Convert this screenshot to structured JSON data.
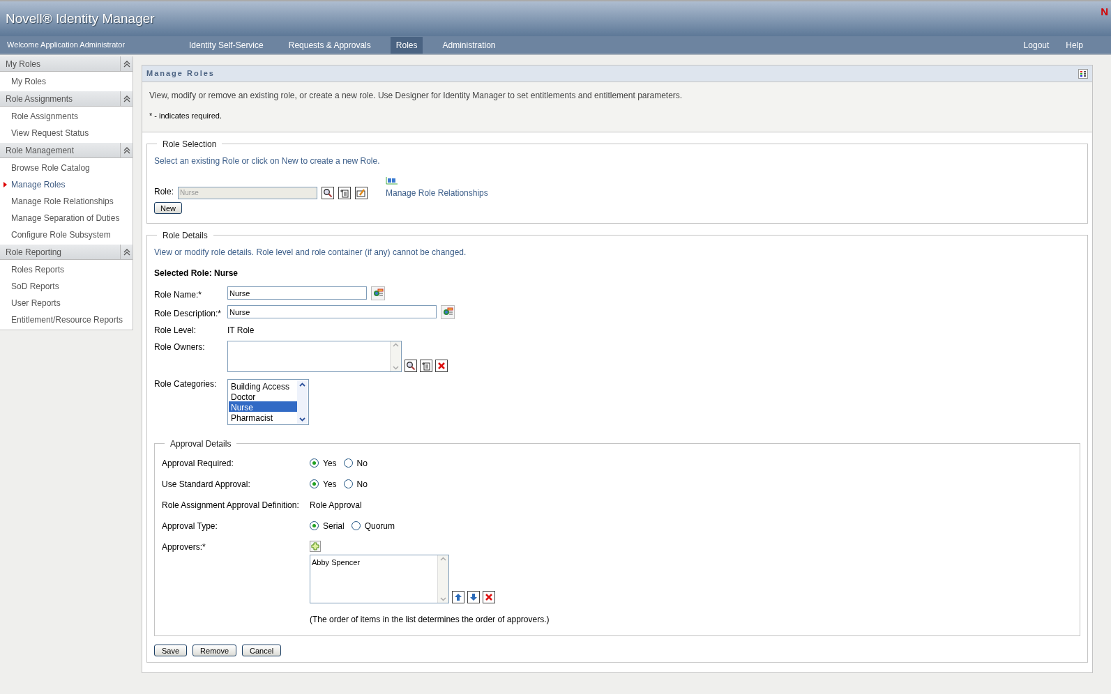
{
  "header": {
    "product": "Novell® Identity Manager",
    "logo_letter": "N"
  },
  "nav": {
    "welcome": "Welcome Application Administrator",
    "tabs": [
      {
        "label": "Identity Self-Service",
        "selected": false
      },
      {
        "label": "Requests & Approvals",
        "selected": false
      },
      {
        "label": "Roles",
        "selected": true
      },
      {
        "label": "Administration",
        "selected": false
      }
    ],
    "links": [
      "Logout",
      "Help"
    ]
  },
  "sidebar": {
    "sections": [
      {
        "title": "My Roles",
        "items": [
          {
            "label": "My Roles",
            "selected": false
          }
        ]
      },
      {
        "title": "Role Assignments",
        "items": [
          {
            "label": "Role Assignments",
            "selected": false
          },
          {
            "label": "View Request Status",
            "selected": false
          }
        ]
      },
      {
        "title": "Role Management",
        "items": [
          {
            "label": "Browse Role Catalog",
            "selected": false
          },
          {
            "label": "Manage Roles",
            "selected": true
          },
          {
            "label": "Manage Role Relationships",
            "selected": false
          },
          {
            "label": "Manage Separation of Duties",
            "selected": false
          },
          {
            "label": "Configure Role Subsystem",
            "selected": false
          }
        ]
      },
      {
        "title": "Role Reporting",
        "items": [
          {
            "label": "Roles Reports",
            "selected": false
          },
          {
            "label": "SoD Reports",
            "selected": false
          },
          {
            "label": "User Reports",
            "selected": false
          },
          {
            "label": "Entitlement/Resource Reports",
            "selected": false
          }
        ]
      }
    ]
  },
  "panel": {
    "title": "Manage Roles",
    "intro": "View, modify or remove an existing role, or create a new role. Use Designer for Identity Manager to set entitlements and entitlement parameters.",
    "required_note": "* - indicates required.",
    "role_selection": {
      "legend": "Role Selection",
      "hint": "Select an existing Role or click on New to create a new Role.",
      "role_label": "Role:",
      "role_value": "Nurse",
      "relationships_link": "Manage Role Relationships",
      "new_button": "New"
    },
    "role_details": {
      "legend": "Role Details",
      "hint": "View or modify role details. Role level and role container (if any) cannot be changed.",
      "selected_role": "Selected Role: Nurse",
      "name_label": "Role Name:*",
      "name_value": "Nurse",
      "description_label": "Role Description:*",
      "description_value": "Nurse",
      "level_label": "Role Level:",
      "level_value": "IT Role",
      "owners_label": "Role Owners:",
      "categories_label": "Role Categories:",
      "categories": [
        {
          "label": "Building Access",
          "selected": false
        },
        {
          "label": "Doctor",
          "selected": false
        },
        {
          "label": "Nurse",
          "selected": true
        },
        {
          "label": "Pharmacist",
          "selected": false
        }
      ]
    },
    "approval": {
      "legend": "Approval Details",
      "radio_rows": [
        {
          "label": "Approval Required:",
          "options": [
            {
              "label": "Yes",
              "selected": true
            },
            {
              "label": "No",
              "selected": false
            }
          ]
        },
        {
          "label": "Use Standard Approval:",
          "options": [
            {
              "label": "Yes",
              "selected": true
            },
            {
              "label": "No",
              "selected": false
            }
          ]
        }
      ],
      "definition_label": "Role Assignment Approval Definition:",
      "definition_value": "Role Approval",
      "type_row": {
        "label": "Approval Type:",
        "options": [
          {
            "label": "Serial",
            "selected": true
          },
          {
            "label": "Quorum",
            "selected": false
          }
        ]
      },
      "approvers_label": "Approvers:*",
      "approvers": [
        "Abby Spencer"
      ],
      "order_note": "(The order of items in the list determines the order of approvers.)"
    },
    "buttons": [
      "Save",
      "Remove",
      "Cancel"
    ]
  }
}
